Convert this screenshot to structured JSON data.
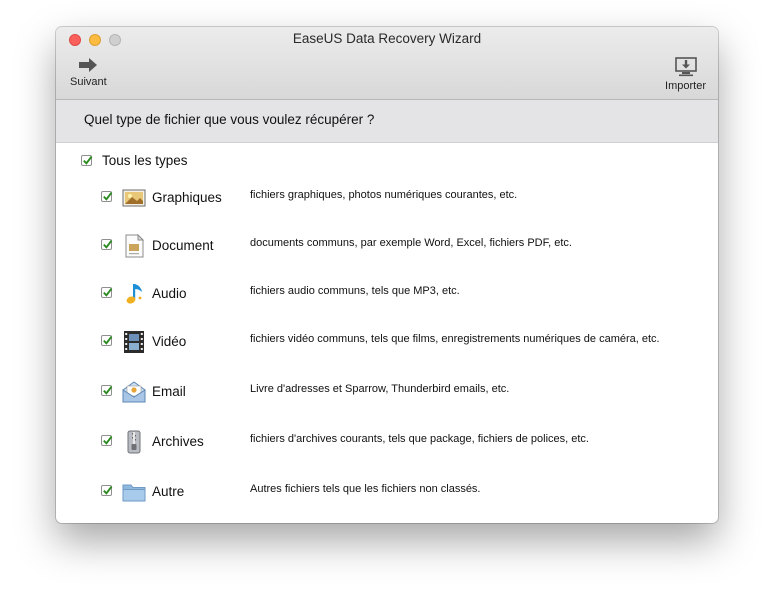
{
  "window": {
    "title": "EaseUS Data Recovery Wizard"
  },
  "toolbar": {
    "next_label": "Suivant",
    "import_label": "Importer"
  },
  "question": "Quel type de fichier que vous voulez récupérer ?",
  "all_types": {
    "label": "Tous les types",
    "checked": true
  },
  "types": [
    {
      "label": "Graphiques",
      "icon": "graphics-icon",
      "checked": true,
      "description": "fichiers graphiques, photos numériques courantes, etc."
    },
    {
      "label": "Document",
      "icon": "document-icon",
      "checked": true,
      "description": "documents communs, par exemple Word, Excel, fichiers PDF, etc."
    },
    {
      "label": "Audio",
      "icon": "music-note-icon",
      "checked": true,
      "description": "fichiers audio communs, tels que MP3, etc."
    },
    {
      "label": "Vidéo",
      "icon": "film-strip-icon",
      "checked": true,
      "description": "fichiers vidéo communs, tels que films, enregistrements numériques de caméra, etc."
    },
    {
      "label": "Email",
      "icon": "envelope-icon",
      "checked": true,
      "description": "Livre d'adresses et Sparrow, Thunderbird emails, etc."
    },
    {
      "label": "Archives",
      "icon": "archive-icon",
      "checked": true,
      "description": "fichiers d'archives courants, tels que package, fichiers de polices, etc."
    },
    {
      "label": "Autre",
      "icon": "folder-icon",
      "checked": true,
      "description": "Autres fichiers tels que les fichiers non classés."
    }
  ]
}
